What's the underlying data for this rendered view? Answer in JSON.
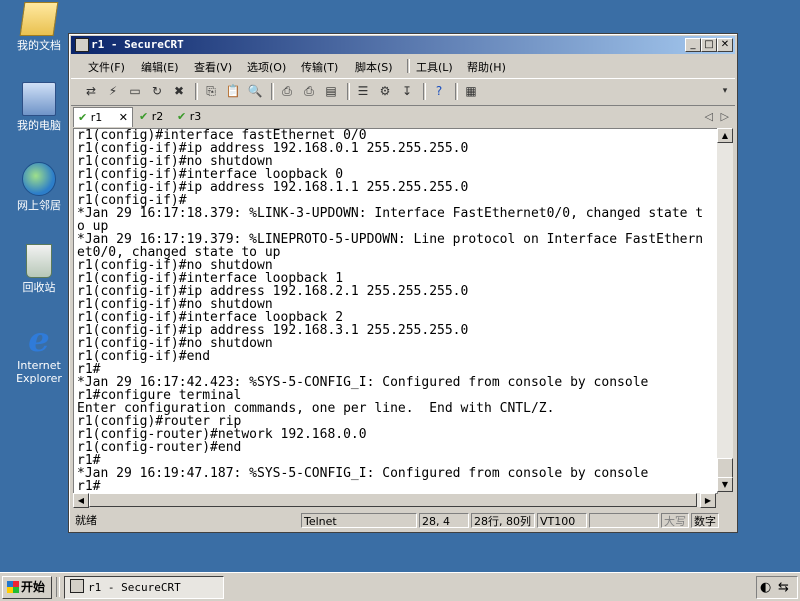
{
  "desktop": {
    "icons": [
      {
        "label": "我的文档",
        "icon": "my-documents-icon"
      },
      {
        "label": "我的电脑",
        "icon": "my-computer-icon"
      },
      {
        "label": "网上邻居",
        "icon": "network-places-icon"
      },
      {
        "label": "回收站",
        "icon": "recycle-bin-icon"
      },
      {
        "label": "Internet Explorer",
        "icon": "internet-explorer-icon"
      }
    ]
  },
  "window": {
    "title": "r1 - SecureCRT",
    "controls": {
      "minimize": "_",
      "maximize": "□",
      "close": "✕"
    },
    "menu": [
      "文件(F)",
      "编辑(E)",
      "查看(V)",
      "选项(O)",
      "传输(T)",
      "脚本(S)",
      "工具(L)",
      "帮助(H)"
    ],
    "tabs": [
      {
        "label": "r1",
        "active": true,
        "close": "✕"
      },
      {
        "label": "r2",
        "active": false
      },
      {
        "label": "r3",
        "active": false
      }
    ],
    "tab_nav": {
      "prev": "◁",
      "next": "▷"
    }
  },
  "terminal": {
    "lines": [
      "r1(config)#interface fastEthernet 0/0",
      "r1(config-if)#ip address 192.168.0.1 255.255.255.0",
      "r1(config-if)#no shutdown",
      "r1(config-if)#interface loopback 0",
      "r1(config-if)#ip address 192.168.1.1 255.255.255.0",
      "r1(config-if)#",
      "*Jan 29 16:17:18.379: %LINK-3-UPDOWN: Interface FastEthernet0/0, changed state t",
      "o up",
      "*Jan 29 16:17:19.379: %LINEPROTO-5-UPDOWN: Line protocol on Interface FastEthern",
      "et0/0, changed state to up",
      "r1(config-if)#no shutdown",
      "r1(config-if)#interface loopback 1",
      "r1(config-if)#ip address 192.168.2.1 255.255.255.0",
      "r1(config-if)#no shutdown",
      "r1(config-if)#interface loopback 2",
      "r1(config-if)#ip address 192.168.3.1 255.255.255.0",
      "r1(config-if)#no shutdown",
      "r1(config-if)#end",
      "r1#",
      "*Jan 29 16:17:42.423: %SYS-5-CONFIG_I: Configured from console by console",
      "r1#configure terminal",
      "Enter configuration commands, one per line.  End with CNTL/Z.",
      "r1(config)#router rip",
      "r1(config-router)#network 192.168.0.0",
      "r1(config-router)#end",
      "r1#",
      "*Jan 29 16:19:47.187: %SYS-5-CONFIG_I: Configured from console by console",
      "r1#"
    ]
  },
  "statusbar": {
    "ready": "就绪",
    "protocol": "Telnet",
    "cursor": "28, 4",
    "size": "28行, 80列",
    "emulation": "VT100",
    "empty": "",
    "caps": "大写",
    "num": "数字"
  },
  "taskbar": {
    "start_label": "开始",
    "task_label": "r1 - SecureCRT"
  },
  "colors": {
    "desktop": "#3a6ea5",
    "titlebar_start": "#0a246a",
    "titlebar_end": "#a6caf0",
    "tab_check": "#3a9a2a"
  }
}
